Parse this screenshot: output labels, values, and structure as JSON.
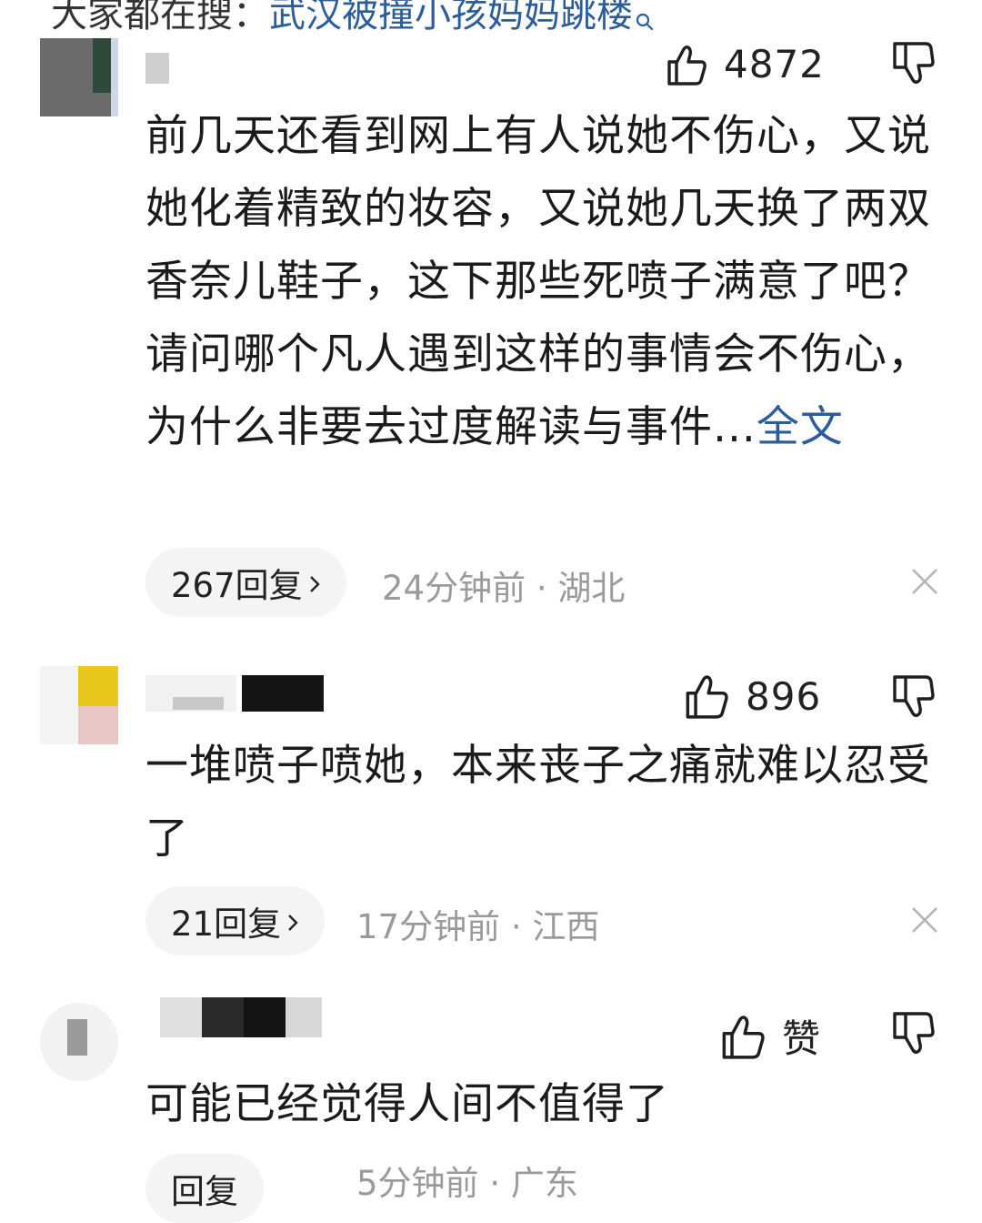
{
  "search_bar": {
    "prefix": "大家都在搜：",
    "query": "武汉被撞小孩妈妈跳楼",
    "icon": "search-icon"
  },
  "comments": [
    {
      "username": "",
      "likes": "4872",
      "body": "前几天还看到网上有人说她不伤心，又说她化着精致的妆容，又说她几天换了两双香奈儿鞋子，这下那些死喷子满意了吧？请问哪个凡人遇到这样的事情会不伤心，为什么非要去过度解读与事件...",
      "more_label": "全文",
      "reply_label": "267回复",
      "time": "24分钟前",
      "separator": "·",
      "location": "湖北"
    },
    {
      "username": "",
      "likes": "896",
      "body": "一堆喷子喷她，本来丧子之痛就难以忍受了",
      "reply_label": "21回复",
      "time": "17分钟前",
      "separator": "·",
      "location": "江西"
    },
    {
      "username": "",
      "likes": "赞",
      "body": "可能已经觉得人间不值得了",
      "reply_label": "回复",
      "time": "5分钟前",
      "separator": "·",
      "location": "广东"
    }
  ],
  "icons": {
    "like": "thumbs-up-icon",
    "dislike": "thumbs-down-icon",
    "close": "close-icon",
    "chevron": "chevron-right-icon"
  },
  "colors": {
    "link": "#2d5c9a",
    "meta": "#9a9a9a",
    "pill_bg": "#f4f4f4"
  }
}
